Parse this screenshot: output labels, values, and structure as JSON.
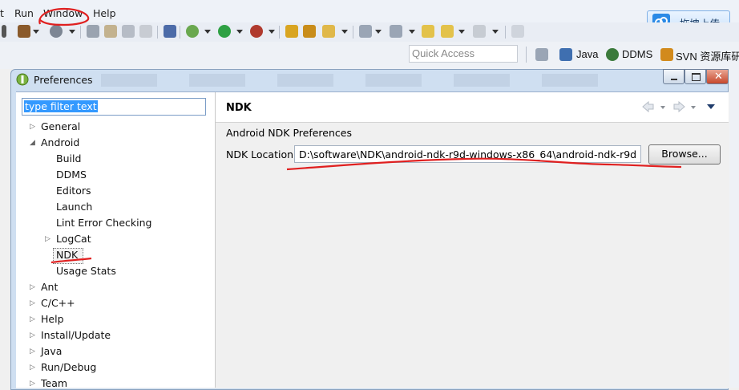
{
  "menubar": {
    "items": [
      "t",
      "Run",
      "Window",
      "Help"
    ]
  },
  "upload_button": {
    "label": "拖拽上传"
  },
  "quick_access": {
    "placeholder": "Quick Access"
  },
  "perspectives": [
    "Java",
    "DDMS",
    "SVN 资源库研究"
  ],
  "dialog": {
    "title": "Preferences",
    "filter_text": "type filter text",
    "tree": [
      {
        "label": "General",
        "level": 0,
        "expandable": true
      },
      {
        "label": "Android",
        "level": 0,
        "expanded": true
      },
      {
        "label": "Build",
        "level": 1
      },
      {
        "label": "DDMS",
        "level": 1
      },
      {
        "label": "Editors",
        "level": 1
      },
      {
        "label": "Launch",
        "level": 1
      },
      {
        "label": "Lint Error Checking",
        "level": 1
      },
      {
        "label": "LogCat",
        "level": 1,
        "expandable": true
      },
      {
        "label": "NDK",
        "level": 1,
        "selected": true
      },
      {
        "label": "Usage Stats",
        "level": 1
      },
      {
        "label": "Ant",
        "level": 0,
        "expandable": true
      },
      {
        "label": "C/C++",
        "level": 0,
        "expandable": true
      },
      {
        "label": "Help",
        "level": 0,
        "expandable": true
      },
      {
        "label": "Install/Update",
        "level": 0,
        "expandable": true
      },
      {
        "label": "Java",
        "level": 0,
        "expandable": true
      },
      {
        "label": "Run/Debug",
        "level": 0,
        "expandable": true
      },
      {
        "label": "Team",
        "level": 0,
        "expandable": true
      }
    ],
    "page": {
      "header": "NDK",
      "section_title": "Android NDK Preferences",
      "location_label": "NDK Location",
      "location_value": "D:\\software\\NDK\\android-ndk-r9d-windows-x86_64\\android-ndk-r9d",
      "browse_label": "Browse..."
    }
  },
  "colors": {
    "accent": "#3399ff",
    "annotation": "#e02020",
    "titlebar": "#cfdff1"
  }
}
